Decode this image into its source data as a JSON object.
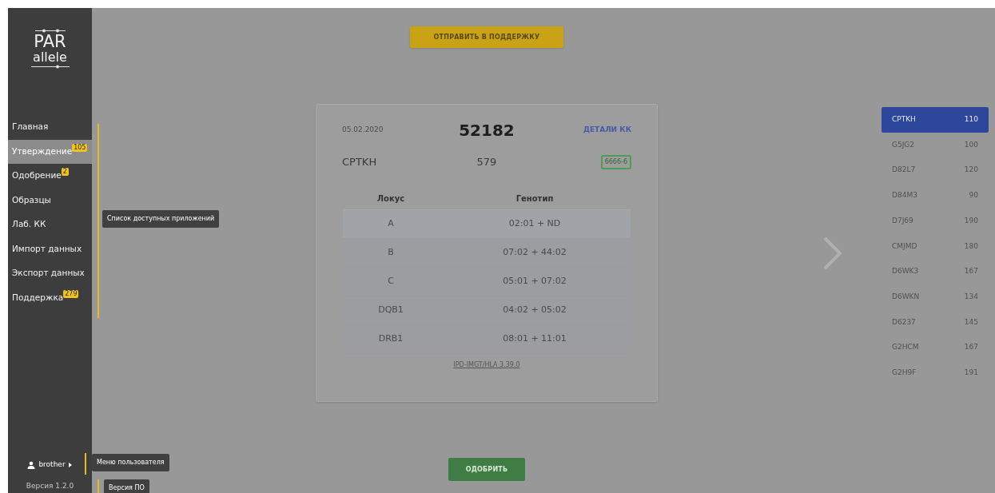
{
  "logo": {
    "top": "PAR",
    "bottom": "allele"
  },
  "nav": [
    {
      "label": "Главная",
      "selected": false
    },
    {
      "label": "Утверждение",
      "selected": true,
      "badge": "105"
    },
    {
      "label": "Одобрение",
      "selected": false,
      "badge": "2"
    },
    {
      "label": "Образцы",
      "selected": false
    },
    {
      "label": "Лаб. КК",
      "selected": false
    },
    {
      "label": "Импорт данных",
      "selected": false
    },
    {
      "label": "Экспорт данных",
      "selected": false
    },
    {
      "label": "Поддержка",
      "selected": false,
      "badge": "279"
    }
  ],
  "user": {
    "name": "brother"
  },
  "version": "Версия 1.2.0",
  "hints": [
    {
      "text": "Список доступных приложений"
    },
    {
      "text": "Меню пользователя"
    },
    {
      "text": "Версия ПО"
    }
  ],
  "support_button": "ОТПРАВИТЬ В ПОДДЕРЖКУ",
  "card": {
    "date": "05.02.2020",
    "number": "52182",
    "details_link": "ДЕТАЛИ КК",
    "sample": "CPTKH",
    "value": "579",
    "tag": "6666-6",
    "columns": [
      "Локус",
      "Генотип"
    ],
    "rows": [
      {
        "locus": "A",
        "genotype": "02:01 + ND"
      },
      {
        "locus": "B",
        "genotype": "07:02 + 44:02"
      },
      {
        "locus": "C",
        "genotype": "05:01 + 07:02"
      },
      {
        "locus": "DQB1",
        "genotype": "04:02 + 05:02"
      },
      {
        "locus": "DRB1",
        "genotype": "08:01 + 11:01"
      }
    ],
    "footer": "IPD-IMGT/HLA 3.39.0"
  },
  "approve_button": "ОДОБРИТЬ",
  "list": [
    {
      "code": "CPTKH",
      "count": "110",
      "selected": true
    },
    {
      "code": "G5JG2",
      "count": "100",
      "selected": false
    },
    {
      "code": "D82L7",
      "count": "120",
      "selected": false
    },
    {
      "code": "D84M3",
      "count": "90",
      "selected": false
    },
    {
      "code": "D7J69",
      "count": "190",
      "selected": false
    },
    {
      "code": "CMJMD",
      "count": "180",
      "selected": false
    },
    {
      "code": "D6WK3",
      "count": "167",
      "selected": false
    },
    {
      "code": "D6WKN",
      "count": "134",
      "selected": false
    },
    {
      "code": "D6237",
      "count": "145",
      "selected": false
    },
    {
      "code": "G2HCM",
      "count": "167",
      "selected": false
    },
    {
      "code": "G2H9F",
      "count": "191",
      "selected": false
    }
  ]
}
